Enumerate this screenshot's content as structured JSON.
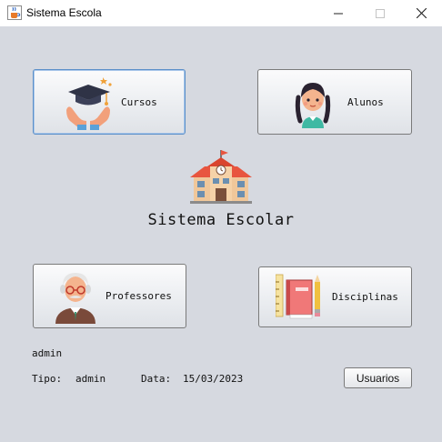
{
  "window": {
    "title": "Sistema Escola",
    "minimize": "—",
    "maximize": "☐",
    "close": "✕",
    "icon": "java-cup-icon"
  },
  "buttons": {
    "cursos": {
      "label": "Cursos",
      "icon": "graduation-cap-hands-icon"
    },
    "alunos": {
      "label": "Alunos",
      "icon": "student-girl-icon"
    },
    "professores": {
      "label": "Professores",
      "icon": "professor-man-icon"
    },
    "disciplinas": {
      "label": "Disciplinas",
      "icon": "books-ruler-pencil-icon"
    }
  },
  "center": {
    "title": "Sistema Escolar",
    "icon": "school-building-icon"
  },
  "status": {
    "user": "admin",
    "tipo_label": "Tipo:",
    "tipo_value": "admin",
    "data_label": "Data:",
    "data_value": "15/03/2023"
  },
  "usuarios_button": "Usuarios",
  "colors": {
    "background": "#d6d9e0",
    "focus_border": "#5b8fc9",
    "school_roof": "#e8553f",
    "school_wall": "#f0c79a"
  }
}
